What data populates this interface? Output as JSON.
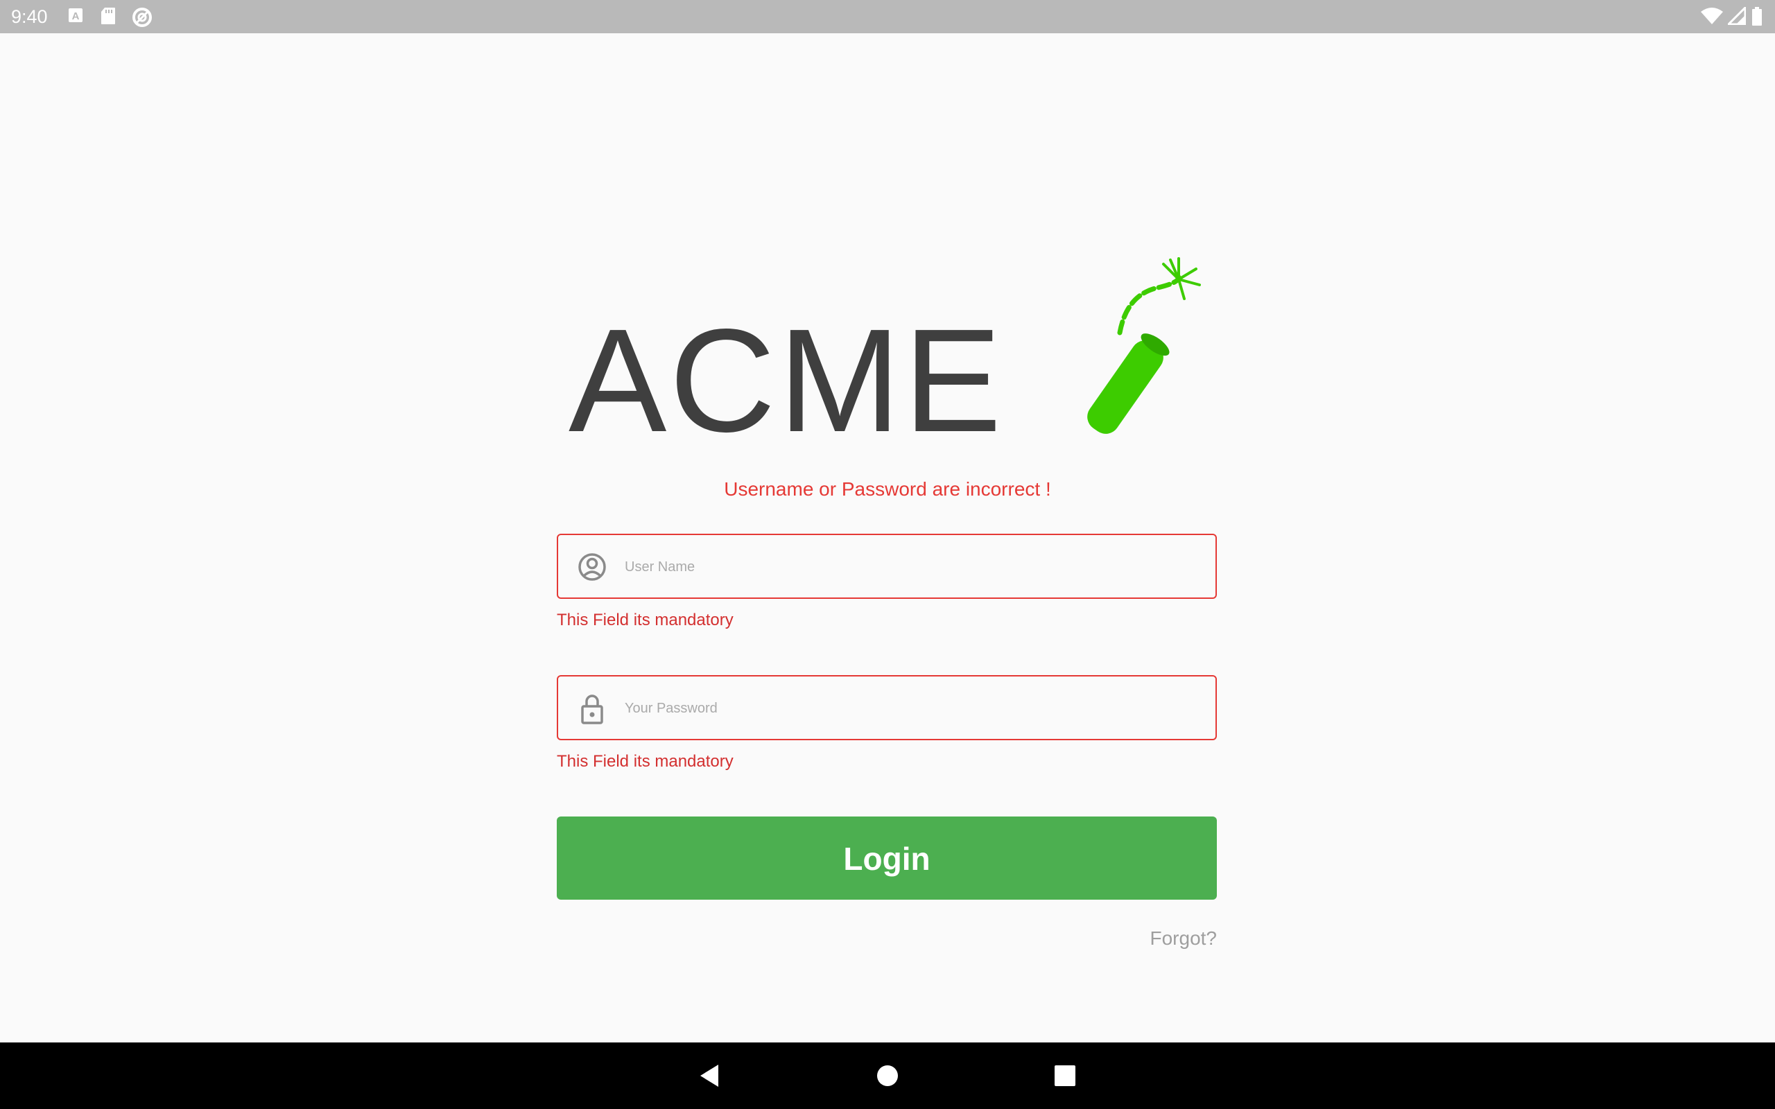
{
  "status_bar": {
    "time": "9:40",
    "left_icons": [
      "font-a-icon",
      "sd-card-icon",
      "data-saver-icon"
    ],
    "right_icons": [
      "wifi-icon",
      "cell-signal-icon",
      "battery-icon"
    ]
  },
  "logo": {
    "text": "ACME",
    "icon": "dynamite-icon",
    "text_color": "#3f3f3f",
    "accent_color": "#3dcc00"
  },
  "login_form": {
    "error_message": "Username or Password are incorrect !",
    "username": {
      "placeholder": "User Name",
      "value": "",
      "icon": "user-circle-icon",
      "error": "This Field its mandatory"
    },
    "password": {
      "placeholder": "Your Password",
      "value": "",
      "icon": "lock-icon",
      "error": "This Field its mandatory"
    },
    "login_label": "Login",
    "forgot_label": "Forgot?"
  },
  "nav_bar": {
    "buttons": [
      "back-icon",
      "home-icon",
      "recents-icon"
    ]
  },
  "colors": {
    "error": "#e53935",
    "primary": "#4caf50",
    "status_bar": "#b9b9b9",
    "nav_bar": "#000000"
  }
}
